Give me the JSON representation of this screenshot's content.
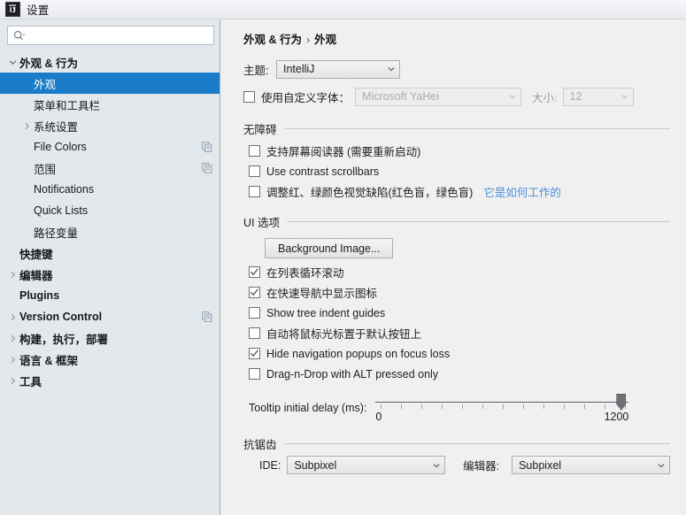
{
  "window": {
    "title": "设置",
    "logo_icon": "intellij-idea-logo"
  },
  "sidebar": {
    "search": {
      "placeholder": "",
      "value": "",
      "icon": "search-icon"
    },
    "items": [
      {
        "label": "外观 & 行为",
        "level": 0,
        "twisty": "chevron-down-icon",
        "bold": true,
        "selected": false,
        "copy": false
      },
      {
        "label": "外观",
        "level": 1,
        "twisty": "none",
        "bold": false,
        "selected": true,
        "copy": false
      },
      {
        "label": "菜单和工具栏",
        "level": 1,
        "twisty": "none",
        "bold": false,
        "selected": false,
        "copy": false
      },
      {
        "label": "系统设置",
        "level": 1,
        "twisty": "chevron-right-icon",
        "bold": false,
        "selected": false,
        "copy": false
      },
      {
        "label": "File Colors",
        "level": 1,
        "twisty": "none",
        "bold": false,
        "selected": false,
        "copy": true
      },
      {
        "label": "范围",
        "level": 1,
        "twisty": "none",
        "bold": false,
        "selected": false,
        "copy": true
      },
      {
        "label": "Notifications",
        "level": 1,
        "twisty": "none",
        "bold": false,
        "selected": false,
        "copy": false
      },
      {
        "label": "Quick Lists",
        "level": 1,
        "twisty": "none",
        "bold": false,
        "selected": false,
        "copy": false
      },
      {
        "label": "路径变量",
        "level": 1,
        "twisty": "none",
        "bold": false,
        "selected": false,
        "copy": false
      },
      {
        "label": "快捷键",
        "level": 0,
        "twisty": "none",
        "bold": true,
        "selected": false,
        "copy": false
      },
      {
        "label": "编辑器",
        "level": 0,
        "twisty": "chevron-right-icon",
        "bold": true,
        "selected": false,
        "copy": false
      },
      {
        "label": "Plugins",
        "level": 0,
        "twisty": "none",
        "bold": true,
        "selected": false,
        "copy": false
      },
      {
        "label": "Version Control",
        "level": 0,
        "twisty": "chevron-right-icon",
        "bold": true,
        "selected": false,
        "copy": true
      },
      {
        "label": "构建，执行，部署",
        "level": 0,
        "twisty": "chevron-right-icon",
        "bold": true,
        "selected": false,
        "copy": false
      },
      {
        "label": "语言 & 框架",
        "level": 0,
        "twisty": "chevron-right-icon",
        "bold": true,
        "selected": false,
        "copy": false
      },
      {
        "label": "工具",
        "level": 0,
        "twisty": "chevron-right-icon",
        "bold": true,
        "selected": false,
        "copy": false
      }
    ]
  },
  "main": {
    "breadcrumb": {
      "root": "外观 & 行为",
      "separator": "›",
      "leaf": "外观"
    },
    "theme": {
      "label": "主题:",
      "value": "IntelliJ"
    },
    "custom_font": {
      "checkbox_label": "使用自定义字体：",
      "checked": false,
      "font_value": "Microsoft YaHei",
      "size_label": "大小:",
      "size_value": "12",
      "disabled": true
    },
    "accessibility": {
      "title": "无障碍",
      "options": [
        {
          "label": "支持屏幕阅读器 (需要重新启动)",
          "checked": false
        },
        {
          "label": "Use contrast scrollbars",
          "checked": false
        },
        {
          "label": "调整红、绿颜色视觉缺陷(红色盲，绿色盲)",
          "checked": false,
          "link": "它是如何工作的"
        }
      ]
    },
    "ui_options": {
      "title": "UI 选项",
      "background_image_button": "Background Image...",
      "options": [
        {
          "label": "在列表循环滚动",
          "checked": true
        },
        {
          "label": "在快速导航中显示图标",
          "checked": true
        },
        {
          "label": "Show tree indent guides",
          "checked": false
        },
        {
          "label": "自动将鼠标光标置于默认按钮上",
          "checked": false
        },
        {
          "label": "Hide navigation popups on focus loss",
          "checked": true
        },
        {
          "label": "Drag-n-Drop with ALT pressed only",
          "checked": false
        }
      ],
      "tooltip_delay": {
        "label": "Tooltip initial delay (ms):",
        "min": "0",
        "max": "1200",
        "value": "1200"
      }
    },
    "antialiasing": {
      "title": "抗锯齿",
      "ide_label": "IDE:",
      "ide_value": "Subpixel",
      "editor_label": "编辑器:",
      "editor_value": "Subpixel"
    }
  },
  "colors": {
    "selection": "#1a7cc8",
    "link": "#4a90d9",
    "sidebar_bg": "#e3e8ed",
    "panel_bg": "#f0f0f0"
  }
}
